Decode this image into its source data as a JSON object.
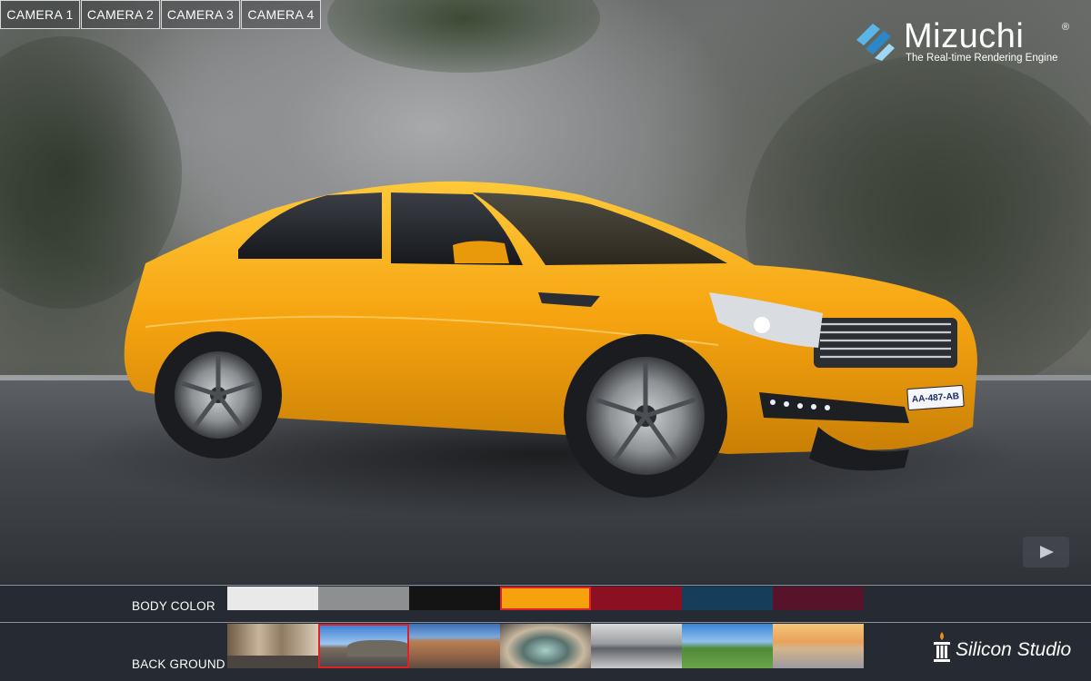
{
  "cameras": [
    "CAMERA 1",
    "CAMERA 2",
    "CAMERA 3",
    "CAMERA 4"
  ],
  "logo": {
    "name": "Mizuchi",
    "registered": "®",
    "tagline": "The Real-time Rendering Engine"
  },
  "car": {
    "plate": "AA-487-AB",
    "selected_color": "#f5a410"
  },
  "body_color": {
    "label": "BODY COLOR",
    "swatches": [
      {
        "name": "white",
        "color": "#e9e9e9",
        "selected": false
      },
      {
        "name": "silver",
        "color": "#8d8f90",
        "selected": false
      },
      {
        "name": "black",
        "color": "#141414",
        "selected": false
      },
      {
        "name": "yellow",
        "color": "#f6a20f",
        "selected": true
      },
      {
        "name": "red",
        "color": "#8b1021",
        "selected": false
      },
      {
        "name": "blue",
        "color": "#163e5b",
        "selected": false
      },
      {
        "name": "burgundy",
        "color": "#571329",
        "selected": false
      }
    ]
  },
  "background": {
    "label": "BACK GROUND",
    "thumbnails": [
      {
        "name": "street",
        "selected": false
      },
      {
        "name": "coastal-road",
        "selected": true
      },
      {
        "name": "plaza",
        "selected": false
      },
      {
        "name": "tunnel",
        "selected": false
      },
      {
        "name": "studio",
        "selected": false
      },
      {
        "name": "park",
        "selected": false
      },
      {
        "name": "pier-sunset",
        "selected": false
      }
    ]
  },
  "brand": {
    "name": "Silicon Studio"
  },
  "colors": {
    "accent": "#e02027",
    "panel": "#252a33"
  },
  "icons": {
    "play": "play-icon",
    "logo": "mizuchi-logo-icon",
    "brand": "silicon-studio-icon"
  }
}
